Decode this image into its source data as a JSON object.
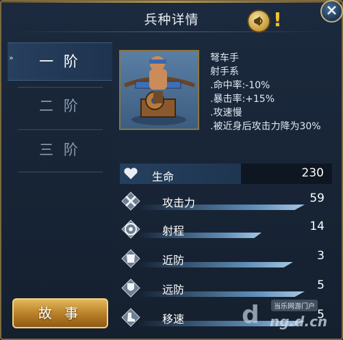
{
  "dialog": {
    "title": "兵种详情",
    "close_label": "×",
    "help_mark": "!"
  },
  "tabs": [
    {
      "label": "一 阶",
      "active": true
    },
    {
      "label": "二 阶",
      "active": false
    },
    {
      "label": "三 阶",
      "active": false
    }
  ],
  "story_button": "故 事",
  "unit": {
    "name": "弩车手",
    "type": "射手系",
    "traits": [
      ".命中率:-10%",
      ".暴击率:+15%",
      ".攻速慢",
      ".被近身后攻击力降为30%"
    ]
  },
  "stats": {
    "hp": {
      "label": "生命",
      "value": "230"
    },
    "rows": [
      {
        "label": "攻击力",
        "value": "59",
        "icon": "crossed-swords-icon",
        "fill": 0.86
      },
      {
        "label": "射程",
        "value": "14",
        "icon": "target-icon",
        "fill": 0.64
      },
      {
        "label": "近防",
        "value": "3",
        "icon": "armor-icon",
        "fill": 0.8
      },
      {
        "label": "远防",
        "value": "5",
        "icon": "shield-icon",
        "fill": 0.86
      },
      {
        "label": "移速",
        "value": "5",
        "icon": "boot-icon",
        "fill": 0.86
      }
    ]
  },
  "watermark": {
    "badge": "当乐网游门户",
    "logo": "d",
    "url": "ng.d.cn"
  },
  "colors": {
    "accent_gold": "#c8a55c",
    "panel": "#1b2a3e",
    "bar": "#5f8eb8"
  }
}
